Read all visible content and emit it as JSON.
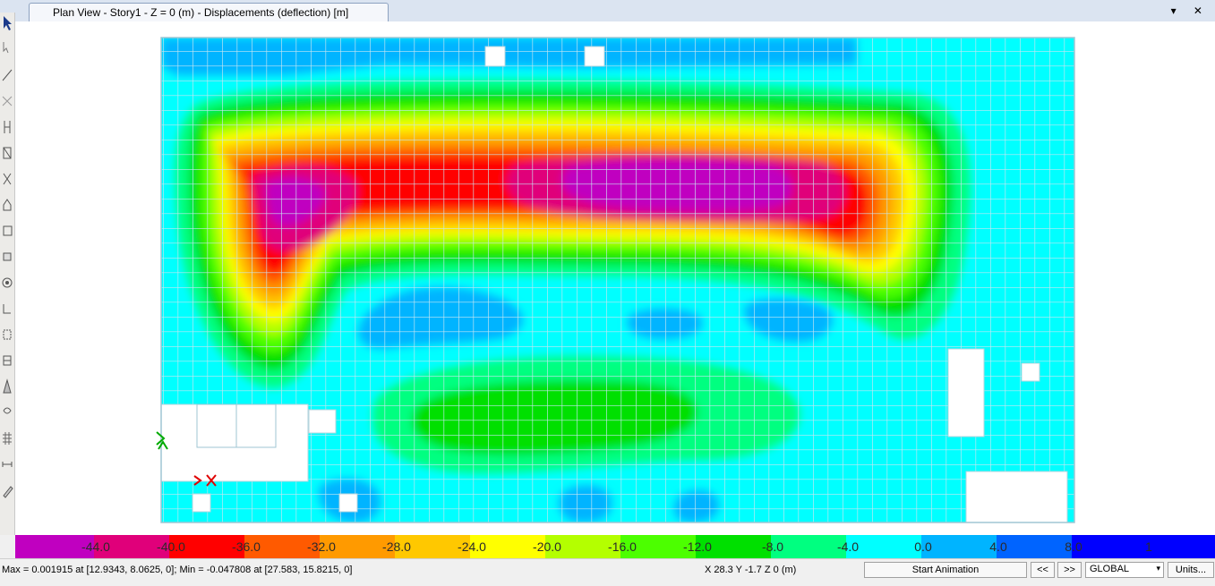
{
  "window": {
    "tab_title": "Plan View - Story1 - Z = 0 (m)  - Displacements (deflection)  [m]",
    "controls": "▾ ✕"
  },
  "toolbar": {
    "tools": [
      "pointer-icon",
      "reshape-icon",
      "draw-line-icon",
      "draw-frame-icon",
      "draw-column-icon",
      "draw-brace-icon",
      "draw-cross-icon",
      "draw-polygon-icon",
      "draw-area-icon",
      "draw-rect-icon",
      "draw-circle-icon",
      "draw-wall-icon",
      "draw-opening-icon",
      "draw-section-icon",
      "draw-cone-icon",
      "draw-spring-icon",
      "draw-grid-icon",
      "draw-dim-icon",
      "draw-pencil-icon"
    ]
  },
  "legend": {
    "ticks": [
      "-44.0",
      "-40.0",
      "-36.0",
      "-32.0",
      "-28.0",
      "-24.0",
      "-20.0",
      "-16.0",
      "-12.0",
      "-8.0",
      "-4.0",
      "0.0",
      "4.0",
      "8.0",
      "1"
    ],
    "colors": [
      "#c000c0",
      "#e0007a",
      "#ff0000",
      "#ff5a00",
      "#ff9a00",
      "#ffc800",
      "#ffff00",
      "#b4ff00",
      "#4cff00",
      "#00e000",
      "#00ff80",
      "#00ffff",
      "#00b4ff",
      "#0064ff",
      "#0000ff"
    ]
  },
  "status": {
    "minmax": "Max = 0.001915 at [12.9343, 8.0625, 0];  Min = -0.047808 at [27.583, 15.8215, 0]",
    "coords": "X 28.3  Y -1.7  Z 0 (m)",
    "start_animation": "Start Animation",
    "prev": "<<",
    "next": ">>",
    "coord_system": "GLOBAL",
    "coord_arrow": "▾",
    "units": "Units..."
  }
}
